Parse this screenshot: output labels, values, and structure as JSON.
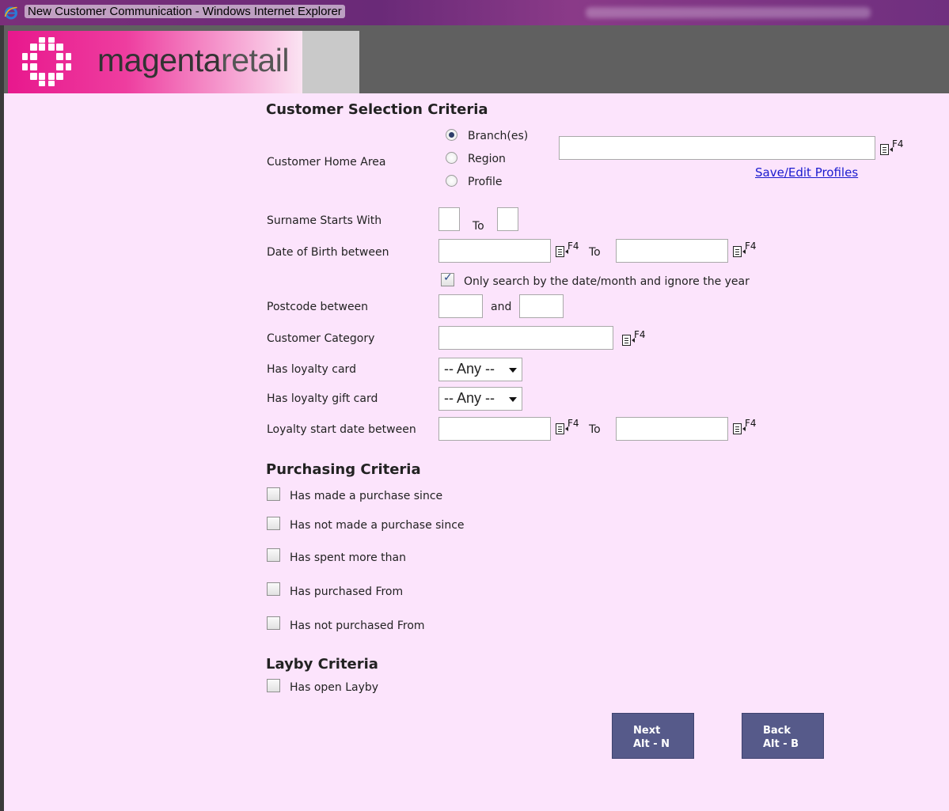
{
  "window": {
    "title": "New Customer Communication - Windows Internet Explorer",
    "icon": "internet-explorer-icon"
  },
  "brand": {
    "name_strong": "magenta",
    "name_light": "retail",
    "logo": "magenta-retail-logo"
  },
  "colors": {
    "background": "#fce4fc",
    "brand": "#e8188d",
    "button": "#565a8a",
    "link": "#1b1bcf",
    "header": "#606060"
  },
  "customer_selection": {
    "heading": "Customer Selection Criteria",
    "home_area": {
      "label": "Customer Home Area",
      "options": [
        "Branch(es)",
        "Region",
        "Profile"
      ],
      "selected": "Branch(es)",
      "value": "",
      "picker_hint": "F4",
      "link": "Save/Edit Profiles"
    },
    "surname": {
      "label": "Surname Starts With",
      "from": "",
      "to_label": "To",
      "to": ""
    },
    "dob": {
      "label": "Date of Birth between",
      "from": "",
      "to_label": "To",
      "to": "",
      "picker_hint": "F4",
      "ignore_year": {
        "label": "Only search by the date/month and ignore the year",
        "checked": true
      }
    },
    "postcode": {
      "label": "Postcode between",
      "from": "",
      "and_label": "and",
      "to": ""
    },
    "category": {
      "label": "Customer Category",
      "value": "",
      "picker_hint": "F4"
    },
    "loyalty_card": {
      "label": "Has loyalty card",
      "selected": "-- Any --"
    },
    "loyalty_gift_card": {
      "label": "Has loyalty gift card",
      "selected": "-- Any --"
    },
    "loyalty_start": {
      "label": "Loyalty start date between",
      "from": "",
      "to_label": "To",
      "to": "",
      "picker_hint": "F4"
    }
  },
  "purchasing": {
    "heading": "Purchasing Criteria",
    "items": [
      {
        "label": "Has made a purchase since",
        "checked": false
      },
      {
        "label": "Has not made a purchase since",
        "checked": false
      },
      {
        "label": "Has spent more than",
        "checked": false
      },
      {
        "label": "Has purchased From",
        "checked": false
      },
      {
        "label": "Has not purchased From",
        "checked": false
      }
    ]
  },
  "layby": {
    "heading": "Layby Criteria",
    "items": [
      {
        "label": "Has open Layby",
        "checked": false
      }
    ]
  },
  "buttons": {
    "next": {
      "label": "Next",
      "shortcut": "Alt - N"
    },
    "back": {
      "label": "Back",
      "shortcut": "Alt - B"
    }
  }
}
